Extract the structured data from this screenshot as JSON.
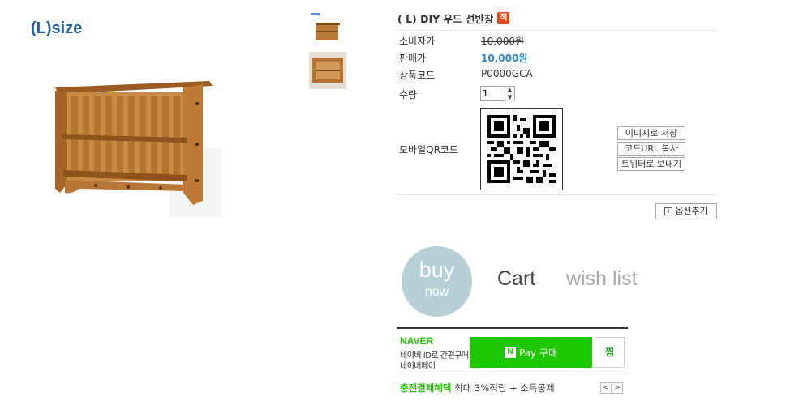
{
  "product": {
    "size_label": "(L)size",
    "title": "( L) DIY 우드 선반장",
    "badge": "적"
  },
  "info": {
    "consumer_price_label": "소비자가",
    "consumer_price": "10,000원",
    "sale_price_label": "판매가",
    "sale_price": "10,000원",
    "code_label": "상품코드",
    "code": "P0000GCA",
    "qty_label": "수량",
    "qty_value": "1",
    "qr_label": "모바일QR코드"
  },
  "qr_actions": {
    "save_image": "이미지로 저장",
    "copy_url": "코드URL 복사",
    "send_twitter": "트위터로 보내기"
  },
  "option_add": "옵션추가",
  "actions": {
    "buy_1": "buy",
    "buy_2": "now",
    "cart": "Cart",
    "wish": "wish list"
  },
  "naverpay": {
    "logo": "NAVER",
    "line1": "네이버 ID로 간편구매",
    "line2": "네이버페이",
    "n_mark": "N",
    "pay_label": "Pay 구매",
    "jjim": "찜",
    "benefit_title": "충전결제혜택",
    "benefit_text": "최대 3%적립 + 소득공제",
    "prev": "<",
    "next": ">"
  },
  "colors": {
    "accent_blue": "#2e86c7",
    "naver_green": "#1ec800",
    "buy_circle": "#b6d0d6",
    "badge_red": "#e8481c"
  }
}
